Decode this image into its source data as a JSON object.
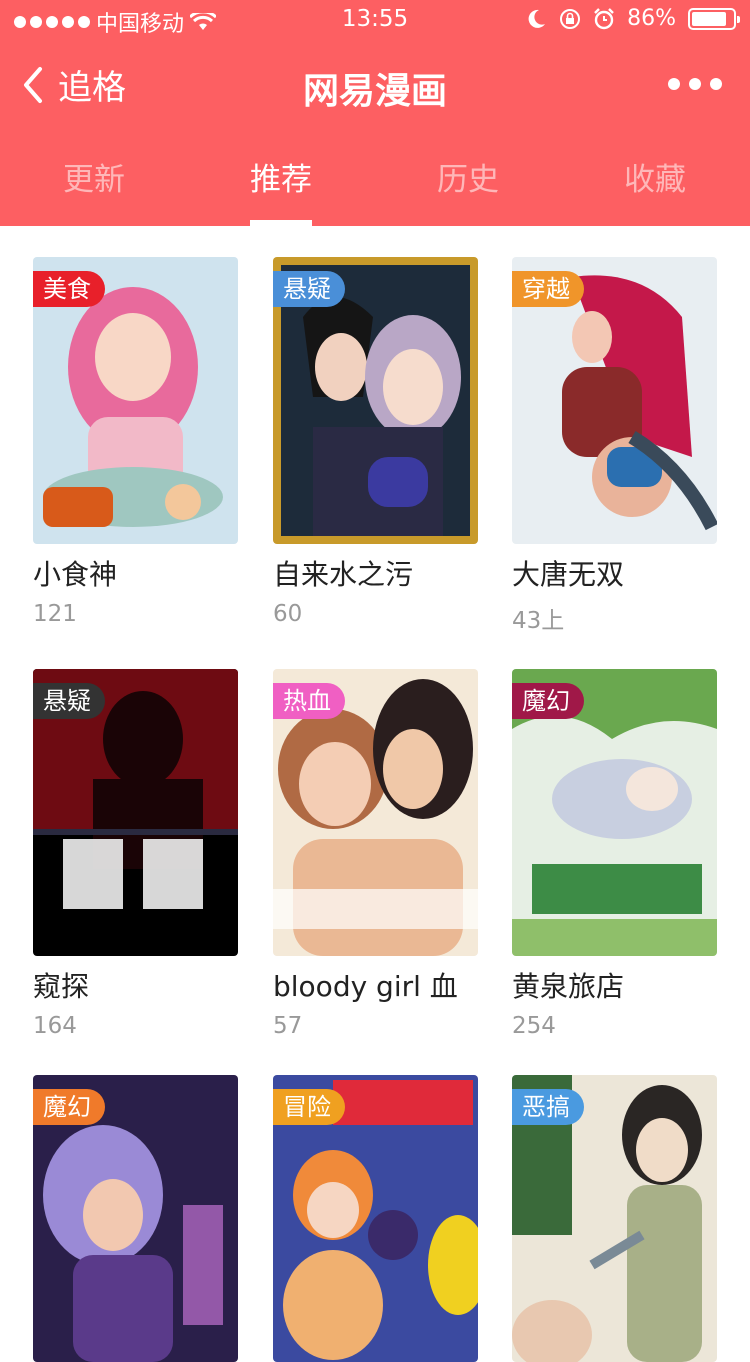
{
  "status": {
    "carrier": "中国移动",
    "time": "13:55",
    "battery": "86%",
    "battery_level": 0.86
  },
  "nav": {
    "back_label": "追格",
    "title": "网易漫画"
  },
  "tabs": [
    {
      "label": "更新",
      "active": false
    },
    {
      "label": "推荐",
      "active": true
    },
    {
      "label": "历史",
      "active": false
    },
    {
      "label": "收藏",
      "active": false
    }
  ],
  "comics": [
    {
      "tag": "美食",
      "tag_color": "#e8202a",
      "name": "小食神",
      "count": "121"
    },
    {
      "tag": "悬疑",
      "tag_color": "#4a8fd8",
      "name": "自来水之污",
      "count": "60"
    },
    {
      "tag": "穿越",
      "tag_color": "#f0952a",
      "name": "大唐无双",
      "count": "43上"
    },
    {
      "tag": "悬疑",
      "tag_color": "#333333",
      "name": "窥探",
      "count": "164"
    },
    {
      "tag": "热血",
      "tag_color": "#f05fc3",
      "name": "bloody girl 血",
      "count": "57"
    },
    {
      "tag": "魔幻",
      "tag_color": "#a01848",
      "name": "黄泉旅店",
      "count": "254"
    },
    {
      "tag": "魔幻",
      "tag_color": "#f07a2a",
      "name": "",
      "count": ""
    },
    {
      "tag": "冒险",
      "tag_color": "#f0a020",
      "name": "",
      "count": ""
    },
    {
      "tag": "恶搞",
      "tag_color": "#4a9ae0",
      "name": "",
      "count": ""
    }
  ]
}
